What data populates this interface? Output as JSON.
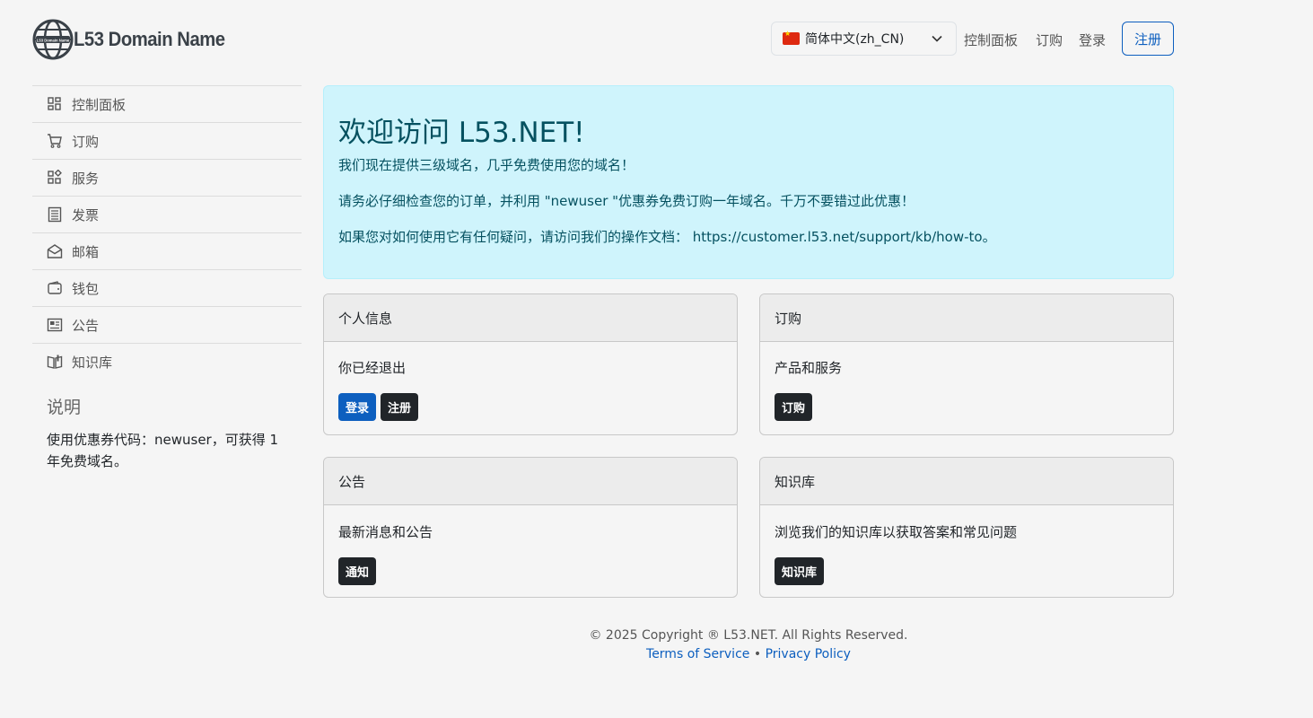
{
  "brand": {
    "name": "L53 Domain Name",
    "logo_badge": "L53 Domain Name"
  },
  "header": {
    "language": "简体中文(zh_CN)",
    "nav": [
      "控制面板",
      "订购",
      "登录"
    ],
    "register_label": "注册"
  },
  "sidebar": {
    "items": [
      {
        "label": "控制面板",
        "icon": "dashboard-icon"
      },
      {
        "label": "订购",
        "icon": "cart-icon"
      },
      {
        "label": "服务",
        "icon": "services-icon"
      },
      {
        "label": "发票",
        "icon": "invoice-icon"
      },
      {
        "label": "邮箱",
        "icon": "mail-icon"
      },
      {
        "label": "钱包",
        "icon": "wallet-icon"
      },
      {
        "label": "公告",
        "icon": "news-icon"
      },
      {
        "label": "知识库",
        "icon": "book-icon"
      }
    ],
    "notes_title": "说明",
    "notes_text": "使用优惠券代码：newuser，可获得 1 年免费域名。"
  },
  "alert": {
    "title": "欢迎访问 L53.NET!",
    "lines": [
      "我们现在提供三级域名，几乎免费使用您的域名！",
      "请务必仔细检查您的订单，并利用 \"newuser \"优惠券免费订购一年域名。千万不要错过此优惠！",
      "如果您对如何使用它有任何疑问，请访问我们的操作文档： https://customer.l53.net/support/kb/how-to。"
    ]
  },
  "cards": {
    "profile": {
      "title": "个人信息",
      "text": "你已经退出",
      "login_label": "登录",
      "register_label": "注册"
    },
    "order": {
      "title": "订购",
      "text": "产品和服务",
      "button_label": "订购"
    },
    "announcements": {
      "title": "公告",
      "text": "最新消息和公告",
      "button_label": "通知"
    },
    "kb": {
      "title": "知识库",
      "text": "浏览我们的知识库以获取答案和常见问题",
      "button_label": "知识库"
    }
  },
  "footer": {
    "copyright": "© 2025 Copyright ® L53.NET. All Rights Reserved.",
    "terms": "Terms of Service",
    "separator": "•",
    "privacy": "Privacy Policy"
  },
  "colors": {
    "primary": "#0d5fbf",
    "dark": "#212529",
    "alert_bg": "#cff4fc",
    "alert_text": "#055160"
  }
}
